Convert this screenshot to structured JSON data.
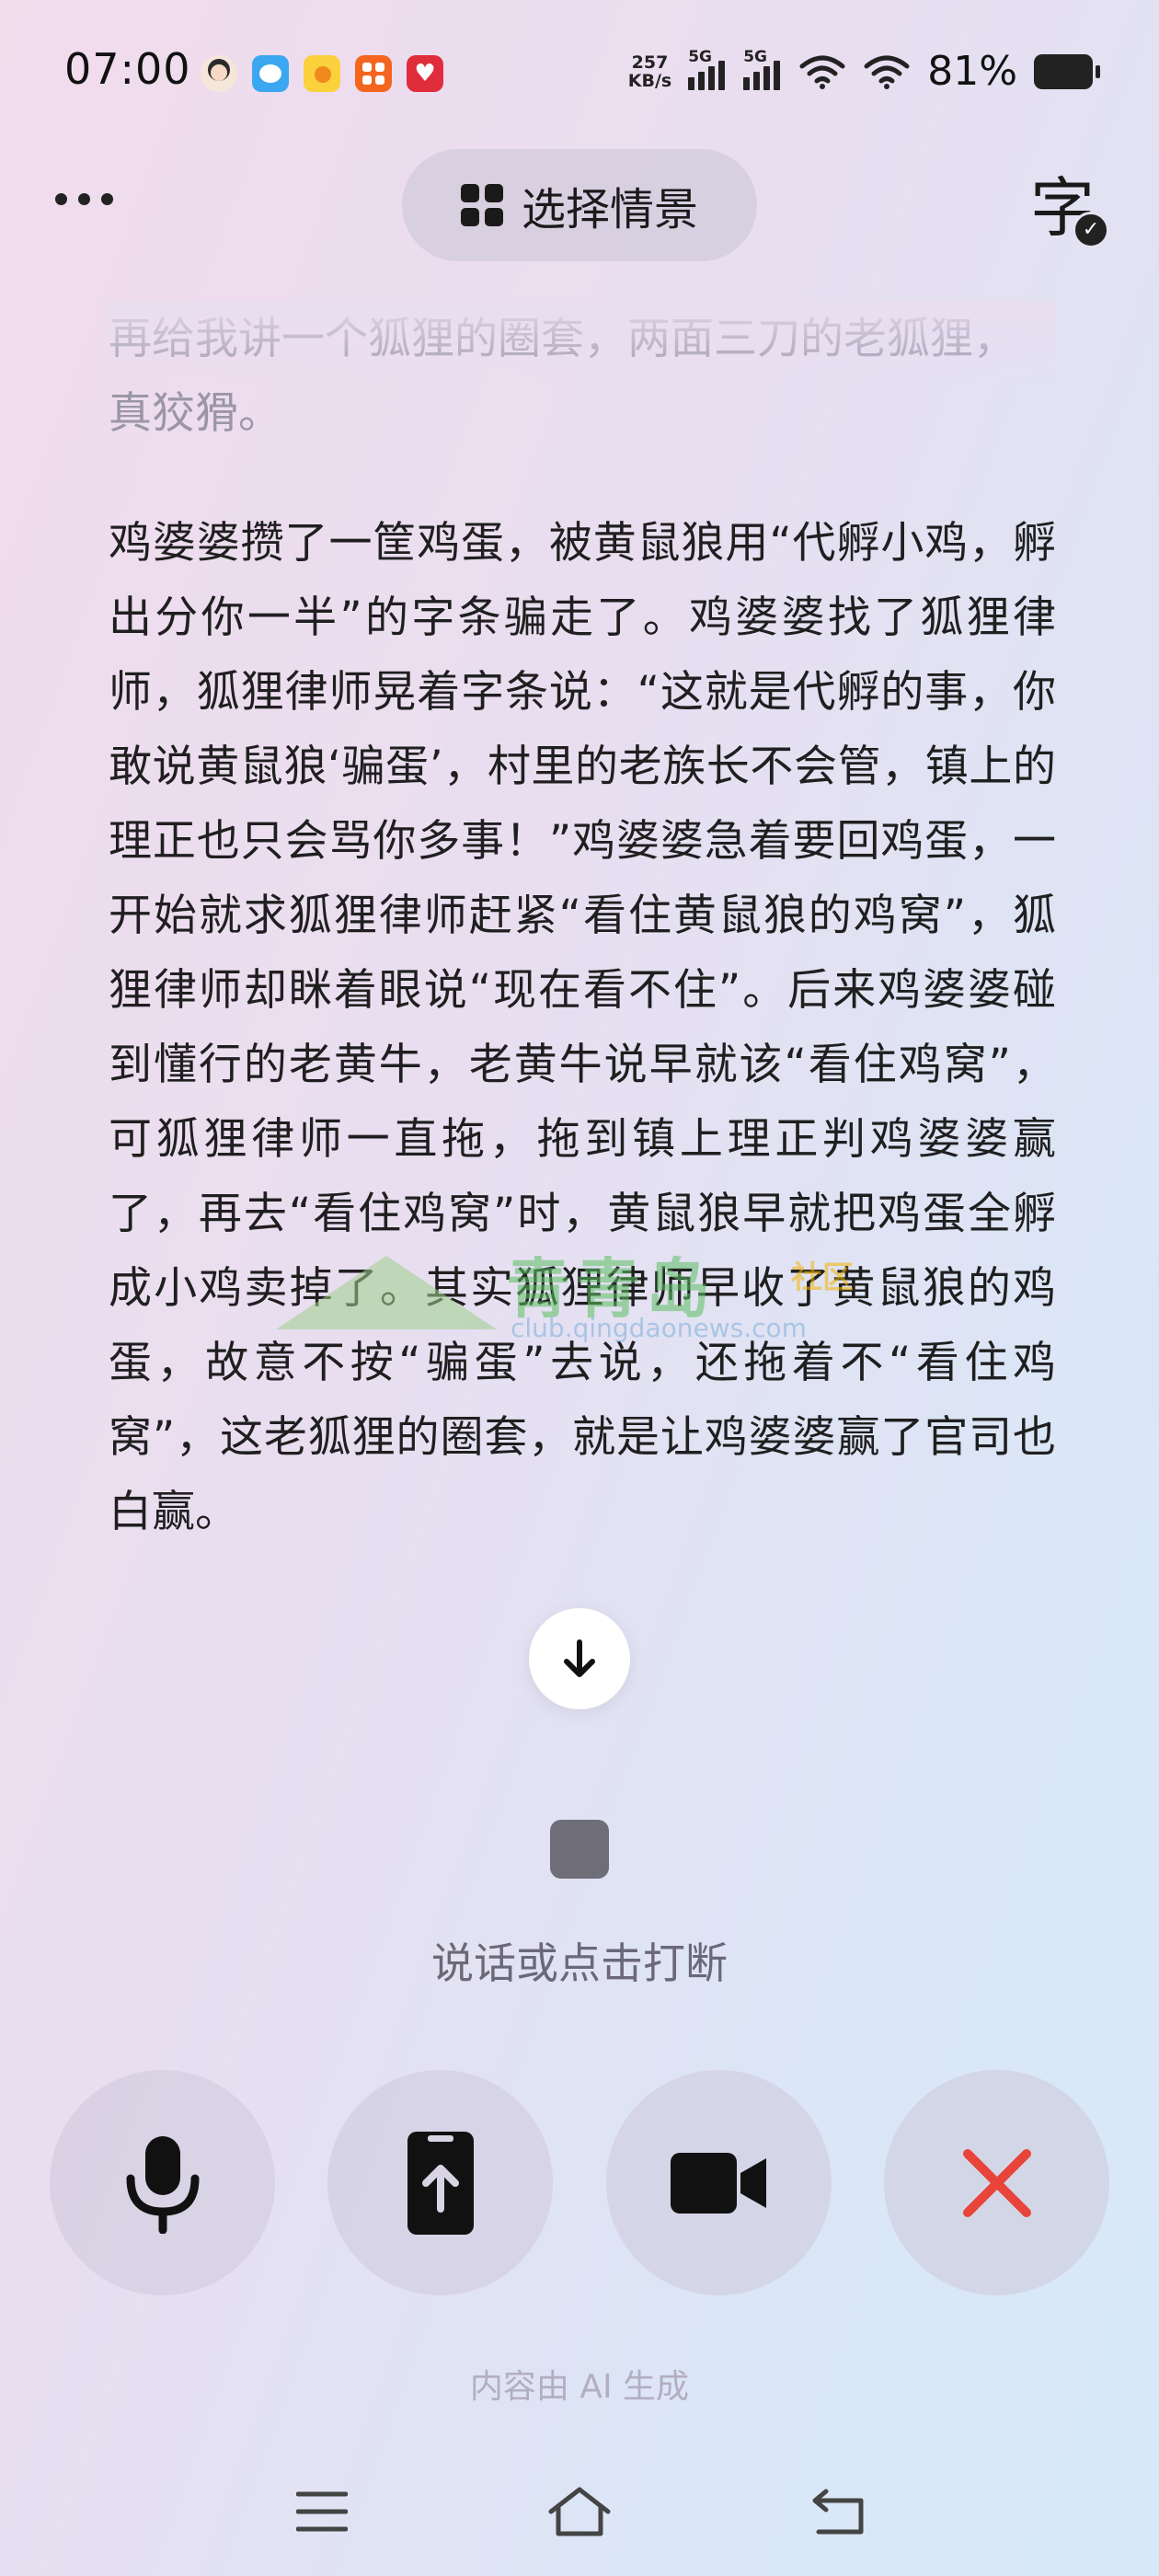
{
  "status": {
    "time": "07:00",
    "net_speed_value": "257",
    "net_speed_unit": "KB/s",
    "signal1_label": "5G",
    "signal2_label": "5G",
    "battery": "81%",
    "app_icons": [
      "avatar-app-icon",
      "bird-app-icon",
      "chick-app-icon",
      "orange-grid-app-icon",
      "red-heart-app-icon"
    ]
  },
  "topbar": {
    "scene_label": "选择情景",
    "caption_label": "字"
  },
  "conversation": {
    "previous_text": "再给我讲一个狐狸的圈套，两面三刀的老狐狸，真狡猾。",
    "story_text": "鸡婆婆攒了一筐鸡蛋，被黄鼠狼用“代孵小鸡，孵出分你一半”的字条骗走了。鸡婆婆找了狐狸律师，狐狸律师晃着字条说：“这就是代孵的事，你敢说黄鼠狼‘骗蛋’，村里的老族长不会管，镇上的理正也只会骂你多事！”鸡婆婆急着要回鸡蛋，一开始就求狐狸律师赶紧“看住黄鼠狼的鸡窝”，狐狸律师却眯着眼说“现在看不住”。后来鸡婆婆碰到懂行的老黄牛，老黄牛说早就该“看住鸡窝”，可狐狸律师一直拖，拖到镇上理正判鸡婆婆赢了，再去“看住鸡窝”时，黄鼠狼早就把鸡蛋全孵成小鸡卖掉了。其实狐狸律师早收了黄鼠狼的鸡蛋，故意不按“骗蛋”去说，还拖着不“看住鸡窝”，这老狐狸的圈套，就是让鸡婆婆赢了官司也白赢。"
  },
  "watermark": {
    "name": "青青岛",
    "sub": "社区",
    "url": "club.qingdaonews.com"
  },
  "voice": {
    "hint": "说话或点击打断"
  },
  "controls": [
    "microphone",
    "share-screen",
    "video-camera",
    "close"
  ],
  "footer": {
    "ai_note": "内容由 AI 生成"
  },
  "colors": {
    "close_red": "#e8443a",
    "text_dark": "#1f1f1f",
    "text_faded": "#9a96a8",
    "stop_gray": "#6f6e78"
  }
}
